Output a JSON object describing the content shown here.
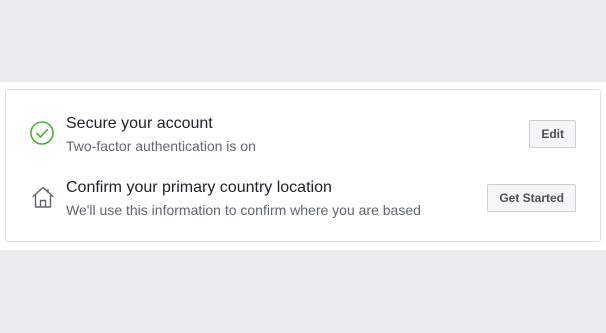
{
  "items": [
    {
      "icon": "check-circle-icon",
      "icon_color": "#42b72a",
      "title": "Secure your account",
      "subtitle": "Two-factor authentication is on",
      "button": "Edit"
    },
    {
      "icon": "home-icon",
      "icon_color": "#606770",
      "title": "Confirm your primary country location",
      "subtitle": "We'll use this information to confirm where you are based",
      "button": "Get Started"
    }
  ]
}
